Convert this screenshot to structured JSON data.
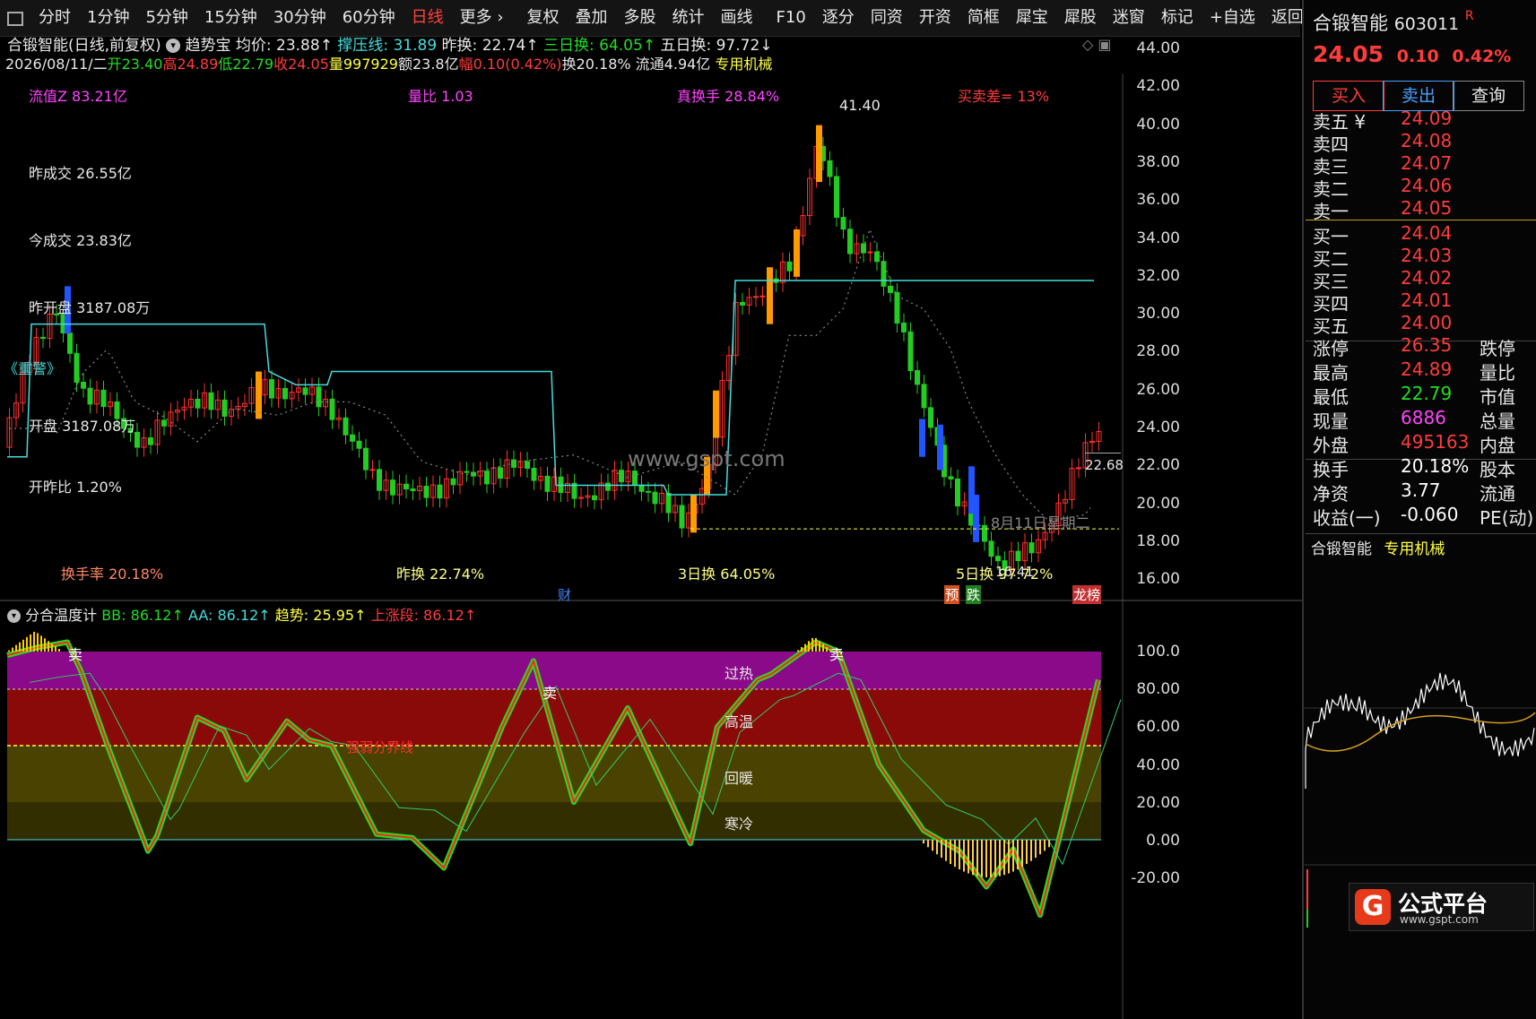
{
  "toolbar": {
    "items": [
      "分时",
      "1分钟",
      "5分钟",
      "15分钟",
      "30分钟",
      "60分钟",
      "日线",
      "更多 ›",
      "复权",
      "叠加",
      "多股",
      "统计",
      "画线",
      "F10",
      "逐分",
      "同资",
      "开资",
      "简框",
      "犀宝",
      "犀股",
      "迷窗",
      "标记",
      "+自选",
      "返回"
    ],
    "active_index": 6
  },
  "header": {
    "title": "合锻智能(日线,前复权)",
    "indicator_name": "趋势宝",
    "avg_label": "均价: 23.88↑",
    "pressure_label": "撑压线: 31.89",
    "prev_turn": "昨换: 22.74↑",
    "three_day_turn": "三日换: 64.05↑",
    "five_day_turn": "五日换: 97.72↓",
    "line2_date": "2026/08/11/二",
    "line2_open": "开23.40",
    "line2_high": "高24.89",
    "line2_low": "低22.79",
    "line2_close": "收24.05",
    "line2_vol": "量997929",
    "line2_amount": "额23.8亿",
    "line2_change": "幅0.10(0.42%)",
    "line2_turn": "换20.18%",
    "line2_float": "流通4.94亿",
    "line2_sector": "专用机械"
  },
  "overlay_labels": {
    "float_cap": "流值Z 83.21亿",
    "vol_ratio": "量比 1.03",
    "real_turn": "真换手 28.84%",
    "bid_ask_diff": "买卖差= 13%",
    "prev_volume": "昨成交 26.55亿",
    "today_volume": "今成交 23.83亿",
    "prev_open": "昨开盘 3187.08万",
    "alert": "《重警》",
    "open": "开盘 3187.08万",
    "open_ratio": "开昨比 1.20%",
    "turnover": "换手率 20.18%",
    "prev_turnover": "昨换 22.74%",
    "three_day": "3日换 64.05%",
    "five_day": "5日换 97.72%",
    "high_marker": "41.40",
    "low_marker": "16.41",
    "price_tag": "22.68",
    "date_marker": "8月11日星期二",
    "watermark": "www.gspt.com",
    "cai": "财",
    "yu": "预",
    "die": "跌",
    "bang": "龙榜"
  },
  "price_axis": [
    "44.00",
    "42.00",
    "40.00",
    "38.00",
    "36.00",
    "34.00",
    "32.00",
    "30.00",
    "28.00",
    "26.00",
    "24.00",
    "22.00",
    "20.00",
    "18.00",
    "16.00"
  ],
  "indicator": {
    "name": "分合温度计",
    "bb": "BB: 86.12↑",
    "aa": "AA: 86.12↑",
    "trend": "趋势: 25.95↑",
    "rise": "上涨段: 86.12↑",
    "zones": [
      "过热",
      "高温",
      "回暖",
      "寒冷"
    ],
    "sell_label": "卖",
    "weak_label": "强弱分界线",
    "axis": [
      "100.0",
      "80.00",
      "60.00",
      "40.00",
      "20.00",
      "0.00",
      "-20.00"
    ]
  },
  "quote": {
    "name": "合锻智能",
    "code": "603011",
    "flag": "R",
    "price": "24.05",
    "change": "0.10",
    "pct": "0.42%",
    "buy_btn": "买入",
    "sell_btn": "卖出",
    "query_btn": "查询",
    "asks": [
      {
        "label": "卖五 ¥",
        "price": "24.09"
      },
      {
        "label": "卖四",
        "price": "24.08"
      },
      {
        "label": "卖三",
        "price": "24.07"
      },
      {
        "label": "卖二",
        "price": "24.06"
      },
      {
        "label": "卖一",
        "price": "24.05"
      }
    ],
    "bids": [
      {
        "label": "买一",
        "price": "24.04"
      },
      {
        "label": "买二",
        "price": "24.03"
      },
      {
        "label": "买三",
        "price": "24.02"
      },
      {
        "label": "买四",
        "price": "24.01"
      },
      {
        "label": "买五",
        "price": "24.00"
      }
    ],
    "stats": [
      {
        "k": "涨停",
        "v": "26.35",
        "k2": "跌停",
        "color": "#ff3c3c"
      },
      {
        "k": "最高",
        "v": "24.89",
        "k2": "量比",
        "color": "#ff3c3c"
      },
      {
        "k": "最低",
        "v": "22.79",
        "k2": "市值",
        "color": "#22dd22"
      },
      {
        "k": "现量",
        "v": "6886",
        "k2": "总量",
        "color": "#ff44ff"
      },
      {
        "k": "外盘",
        "v": "495163",
        "k2": "内盘",
        "color": "#ff3c3c"
      }
    ],
    "stats2": [
      {
        "k": "换手",
        "v": "20.18%",
        "k2": "股本"
      },
      {
        "k": "净资",
        "v": "3.77",
        "k2": "流通"
      },
      {
        "k": "收益(一)",
        "v": "-0.060",
        "k2": "PE(动)"
      }
    ],
    "footer_name": "合锻智能",
    "footer_sector": "专用机械",
    "logo_text": "公式平台",
    "logo_url": "www.gspt.com"
  }
}
